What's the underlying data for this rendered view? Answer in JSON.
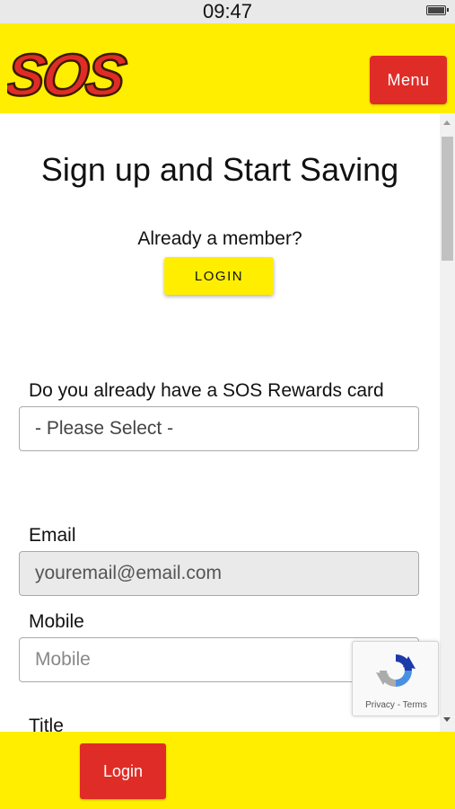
{
  "status_bar": {
    "time": "09:47"
  },
  "header": {
    "logo_text": "SOS",
    "menu_label": "Menu"
  },
  "main": {
    "title": "Sign up and Start Saving",
    "already_member": "Already a member?",
    "login_label": "LOGIN",
    "rewards_question": "Do you already have a SOS Rewards card",
    "rewards_select_value": "- Please Select -",
    "email_label": "Email",
    "email_value": "youremail@email.com",
    "mobile_label": "Mobile",
    "mobile_placeholder": "Mobile",
    "title_field_label": "Title"
  },
  "recaptcha": {
    "links": "Privacy - Terms"
  },
  "footer": {
    "login_label": "Login"
  },
  "colors": {
    "brand_yellow": "#ffee00",
    "brand_red": "#e02c27"
  }
}
